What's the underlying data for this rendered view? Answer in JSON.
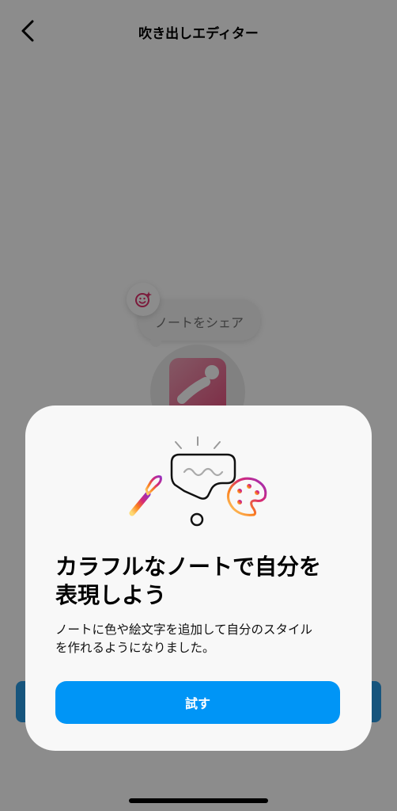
{
  "header": {
    "back_icon": "chevron-left-icon",
    "title": "吹き出しエディター"
  },
  "editor": {
    "emoji_icon": "emoji-sparkle-icon",
    "note_placeholder": "ノートをシェア"
  },
  "dialog": {
    "illustration_icon": "paintbrush-speech-bubble-palette-icon",
    "headline_lines": [
      "カラフルなノートで自分を",
      "表現しよう"
    ],
    "description_lines": [
      "ノートに色や絵文字を追加して自分のスタイル",
      "を作れるようになりました。"
    ],
    "cta_label": "試す"
  },
  "colors": {
    "accent": "#0095f6",
    "sheet_background": "#f8f8f8",
    "overlay": "rgba(0,0,0,0.45)"
  }
}
